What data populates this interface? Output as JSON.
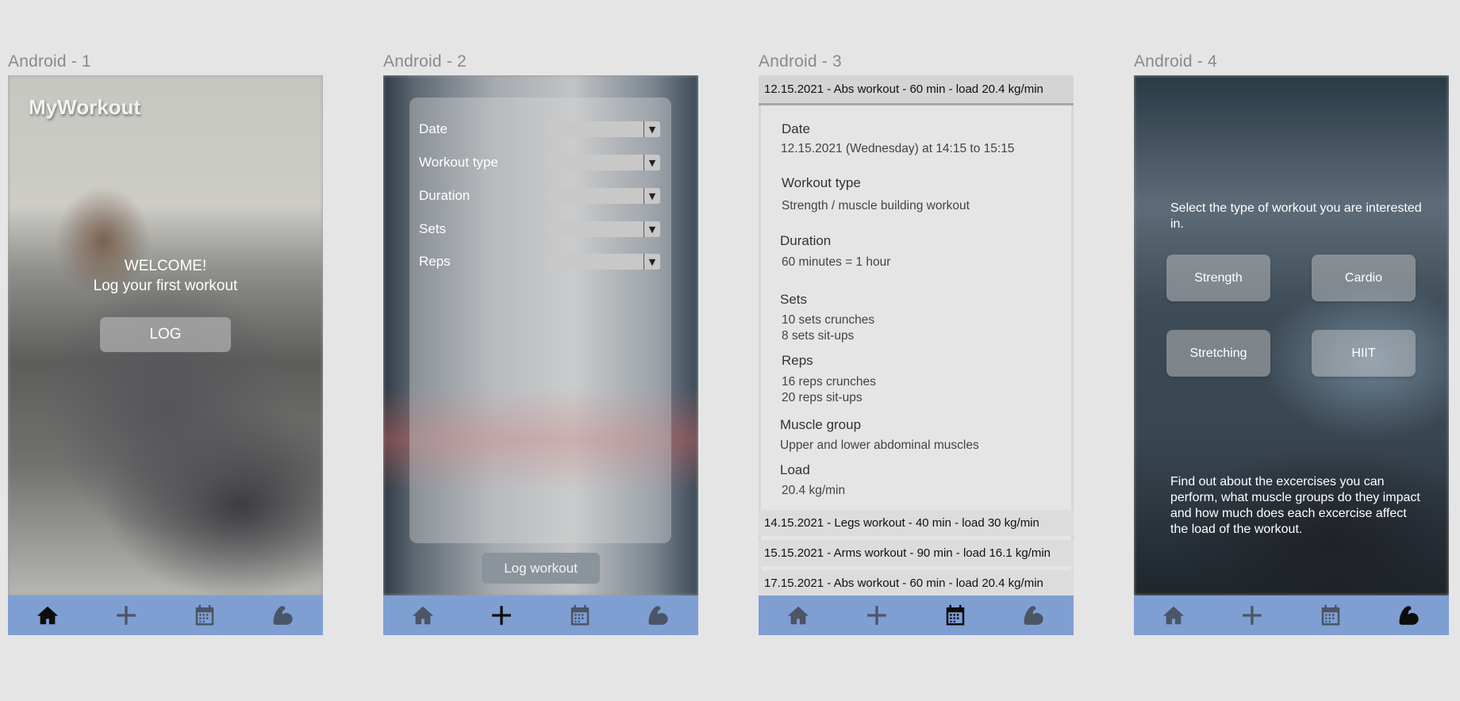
{
  "frames": [
    {
      "label": "Android - 1"
    },
    {
      "label": "Android - 2"
    },
    {
      "label": "Android - 3"
    },
    {
      "label": "Android - 4"
    }
  ],
  "nav": {
    "icons": [
      "home-icon",
      "plus-icon",
      "calendar-icon",
      "flexed-arm-icon"
    ],
    "bar_color": "#7f9fd3",
    "active_per_frame": [
      "home",
      "add",
      "calendar",
      "muscle"
    ]
  },
  "home": {
    "app_title": "MyWorkout",
    "welcome": "WELCOME!",
    "subtitle": "Log your first workout",
    "log_button": "LOG"
  },
  "log_form": {
    "fields": [
      {
        "label": "Date"
      },
      {
        "label": "Workout type"
      },
      {
        "label": "Duration"
      },
      {
        "label": "Sets"
      },
      {
        "label": "Reps"
      }
    ],
    "dropdown_arrow": "▼",
    "submit": "Log workout"
  },
  "history": {
    "entries": [
      {
        "title": "12.15.2021 - Abs workout - 60 min - load 20.4 kg/min"
      },
      {
        "title": "14.15.2021 - Legs workout - 40 min - load 30 kg/min"
      },
      {
        "title": "15.15.2021 - Arms workout - 90 min - load 16.1 kg/min"
      },
      {
        "title": "17.15.2021 - Abs workout - 60 min - load 20.4 kg/min"
      }
    ],
    "detail": {
      "date_label": "Date",
      "date_value": "12.15.2021 (Wednesday) at 14:15 to 15:15",
      "type_label": "Workout type",
      "type_value": "Strength / muscle building workout",
      "duration_label": "Duration",
      "duration_value": "60 minutes = 1 hour",
      "sets_label": "Sets",
      "sets_line1": "10 sets crunches",
      "sets_line2": "8 sets sit-ups",
      "reps_label": "Reps",
      "reps_line1": "16 reps crunches",
      "reps_line2": "20 reps sit-ups",
      "muscle_label": "Muscle group",
      "muscle_value": "Upper and lower abdominal muscles",
      "load_label": "Load",
      "load_value": "20.4 kg/min"
    }
  },
  "workout_types": {
    "prompt": "Select the type of workout you are interested in.",
    "buttons": [
      "Strength",
      "Cardio",
      "Stretching",
      "HIIT"
    ],
    "info": "Find out about the excercises you can perform, what muscle groups do they impact and how much does each excercise affect the load of the workout."
  }
}
